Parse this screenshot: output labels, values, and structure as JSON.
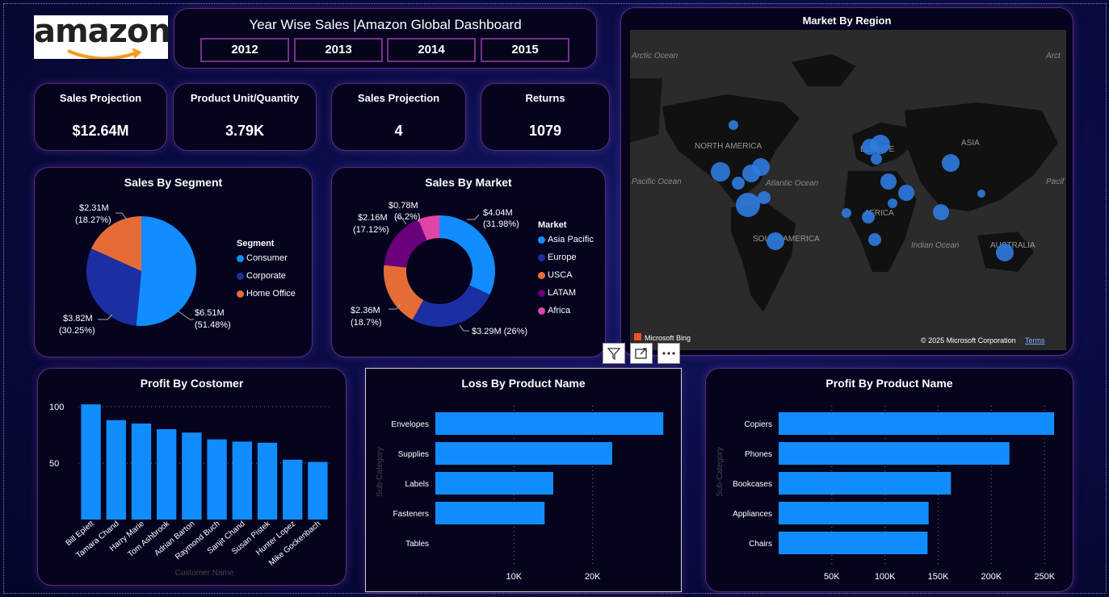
{
  "logo": {
    "text": "amazon"
  },
  "header": {
    "title": "Year Wise Sales |Amazon Global Dashboard",
    "years": [
      "2012",
      "2013",
      "2014",
      "2015"
    ]
  },
  "kpis": [
    {
      "label": "Sales Projection",
      "value": "$12.64M"
    },
    {
      "label": "Product Unit/Quantity",
      "value": "3.79K"
    },
    {
      "label": "Sales Projection",
      "value": "4"
    },
    {
      "label": "Returns",
      "value": "1079"
    }
  ],
  "map": {
    "title": "Market By Region",
    "labels": [
      "Arctic Ocean",
      "Arct",
      "NORTH AMERICA",
      "EUROPE",
      "ASIA",
      "Pacific Ocean",
      "Atlantic Ocean",
      "Pacif",
      "AFRICA",
      "SOUTH AMERICA",
      "Indian Ocean",
      "AUSTRALIA"
    ],
    "bing": "Microsoft Bing",
    "copyright": "© 2025 Microsoft Corporation",
    "terms": "Terms",
    "bubble_color": "#2f7be0"
  },
  "toolbar": {
    "filter": "filter-icon",
    "focus": "focus-mode-icon",
    "more": "more-options-icon"
  },
  "colors": {
    "blue": "#118dff",
    "navy": "#1b2fa3",
    "orange": "#e66c37",
    "purple": "#6b007b",
    "pink": "#e044a7"
  },
  "chart_data": [
    {
      "type": "pie",
      "title": "Sales By Segment",
      "legend_title": "Segment",
      "categories": [
        "Consumer",
        "Corporate",
        "Home Office"
      ],
      "values": [
        6.51,
        3.82,
        2.31
      ],
      "percent": [
        51.48,
        30.25,
        18.27
      ],
      "value_labels": [
        "$6.51M",
        "$3.82M",
        "$2.31M"
      ],
      "percent_labels": [
        "(51.48%)",
        "(30.25%)",
        "(18.27%)"
      ],
      "colors": [
        "#118dff",
        "#1b2fa3",
        "#e66c37"
      ]
    },
    {
      "type": "pie",
      "title": "Sales By Market",
      "legend_title": "Market",
      "categories": [
        "Asia Pacific",
        "Europe",
        "USCA",
        "LATAM",
        "Africa"
      ],
      "values": [
        4.04,
        3.29,
        2.36,
        2.16,
        0.78
      ],
      "percent": [
        31.98,
        26,
        18.7,
        17.12,
        6.2
      ],
      "labels": [
        "$4.04M",
        "(31.98%)",
        "$3.29M (26%)",
        "$2.36M",
        "(18.7%)",
        "$2.16M",
        "(17.12%)",
        "$0.78M",
        "(6.2%)"
      ],
      "colors": [
        "#118dff",
        "#1b2fa3",
        "#e66c37",
        "#6b007b",
        "#e044a7"
      ]
    },
    {
      "type": "bar",
      "title": "Profit By Costomer",
      "xlabel": "Customer Name",
      "categories": [
        "Bill Eplett",
        "Tamara Chand",
        "Harry Marie",
        "Tom Ashbrook",
        "Adrian Barton",
        "Raymond Buch",
        "Sanjit Chand",
        "Susan Pistek",
        "Hunter Lopez",
        "Mike Gockenbach"
      ],
      "values": [
        102,
        88,
        85,
        80,
        77,
        71,
        69,
        68,
        53,
        51
      ],
      "yticks": [
        50,
        100
      ],
      "ytick_labels": [
        "50",
        "100"
      ],
      "ylim": [
        0,
        105
      ],
      "color": "#118dff"
    },
    {
      "type": "bar",
      "orientation": "horizontal",
      "title": "Loss By Product Name",
      "ylabel": "Sub-Category",
      "categories": [
        "Envelopes",
        "Supplies",
        "Labels",
        "Fasteners",
        "Tables"
      ],
      "values": [
        29000,
        22500,
        15000,
        13900,
        0
      ],
      "xticks": [
        10000,
        20000
      ],
      "xtick_labels": [
        "10K",
        "20K"
      ],
      "xlim": [
        0,
        29800
      ],
      "color": "#118dff"
    },
    {
      "type": "bar",
      "orientation": "horizontal",
      "title": "Profit By Product Name",
      "ylabel": "Sub-Category",
      "categories": [
        "Copiers",
        "Phones",
        "Bookcases",
        "Appliances",
        "Chairs"
      ],
      "values": [
        259000,
        217000,
        162000,
        141000,
        140000
      ],
      "xticks": [
        50000,
        100000,
        150000,
        200000,
        250000
      ],
      "xtick_labels": [
        "50K",
        "100K",
        "150K",
        "200K",
        "250K"
      ],
      "xlim": [
        0,
        262000
      ],
      "color": "#118dff"
    }
  ]
}
